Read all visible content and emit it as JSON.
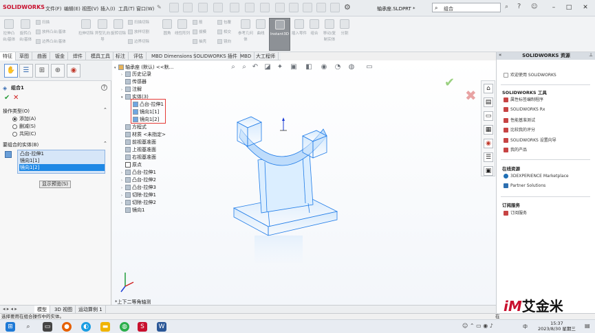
{
  "titlebar": {
    "logo": "SOLIDWORKS",
    "menus": [
      "文件(F)",
      "编辑(E)",
      "视图(V)",
      "插入(I)",
      "工具(T)",
      "窗口(W)"
    ],
    "document": "轴承座.SLDPRT *",
    "search_text": "组合",
    "search_icon": "search-icon"
  },
  "ribbon": {
    "buttons": [
      "拉伸凸台/基体",
      "旋转凸台/基体",
      "拉伸切除",
      "异型孔向导",
      "旋转切除",
      "圆角",
      "线性阵列",
      "参考几何体",
      "曲线",
      "Instant3D",
      "插入零件",
      "组合",
      "移动/复制实体",
      "分割"
    ],
    "small": [
      "扫描",
      "放样凸台/基体",
      "边界凸台/基体",
      "扫描切除",
      "放样切割",
      "边界切除",
      "筋",
      "拔模",
      "抽壳",
      "包覆",
      "相交",
      "镜向"
    ]
  },
  "tabs": [
    "特征",
    "草图",
    "曲面",
    "钣金",
    "焊件",
    "模具工具",
    "标注",
    "评估",
    "MBD Dimensions",
    "SOLIDWORKS 插件",
    "MBD",
    "大工程师"
  ],
  "pm": {
    "title": "组合1",
    "op_type_header": "操作类型(O)",
    "op_add": "添加(A)",
    "op_subtract": "删减(S)",
    "op_common": "共同(C)",
    "bodies_header": "要组合的实体(B)",
    "bodies": [
      "凸台-拉伸1",
      "镜向1[1]",
      "镜向1[2]"
    ],
    "preview_button": "显示预览(S)"
  },
  "tree": {
    "root": "轴承座 (默认) <<默...",
    "items": [
      "历史记录",
      "传感器",
      "注解",
      "实体(3)",
      "凸台-拉伸1",
      "镜向1[1]",
      "镜向1[2]",
      "方程式",
      "材质 <未指定>",
      "前视基准面",
      "上视基准面",
      "右视基准面",
      "原点",
      "凸台-拉伸1",
      "凸台-拉伸2",
      "凸台-拉伸3",
      "切除-拉伸1",
      "切除-拉伸2",
      "镜向1"
    ]
  },
  "viewport": {
    "view_label": "*上下二等角轴测"
  },
  "taskpane": {
    "title": "SOLIDWORKS 资源",
    "welcome": "欢迎使用 SOLIDWORKS",
    "tools_header": "SOLIDWORKS 工具",
    "tools": [
      "属性标签编制程序",
      "SOLIDWORKS Rx",
      "性能基准测试",
      "比较我的评分",
      "SOLIDWORKS 设置向导",
      "我的产品"
    ],
    "online_header": "在线资源",
    "online": [
      "3DEXPERIENCE Marketplace",
      "Partner Solutions"
    ],
    "sub_header": "订阅服务",
    "sub": [
      "订阅服务"
    ]
  },
  "bottom_tabs": [
    "模型",
    "3D 视图",
    "运动算例 1"
  ],
  "status": {
    "text": "选择要用在组合操作中的实体。",
    "right": "在"
  },
  "watermark": {
    "im": "iM",
    "text": "艾金米"
  },
  "taskbar": {
    "time": "15:37",
    "date": "2023/8/30 星期三",
    "lang": "中"
  },
  "colors": {
    "model_edge": "#1e7be8",
    "model_fill": "#c8e2fb",
    "selection": "#1e88e5",
    "highlight_box": "#e53935"
  }
}
